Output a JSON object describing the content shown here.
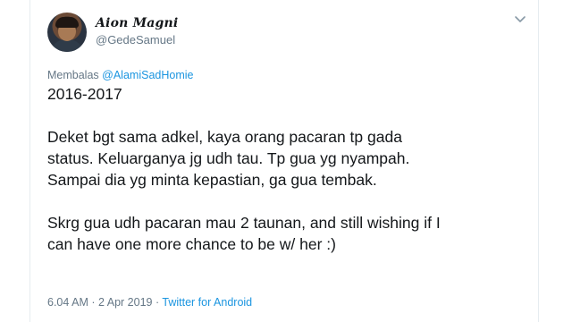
{
  "user": {
    "display_name": "Aion Magni",
    "handle": "@GedeSamuel"
  },
  "reply": {
    "prefix": "Membalas",
    "mention": "@AlamiSadHomie"
  },
  "tweet": {
    "line1": "2016-2017",
    "line2": "Deket bgt sama adkel, kaya orang pacaran tp gada",
    "line3": "status. Keluarganya jg udh tau. Tp gua yg nyampah.",
    "line4": "Sampai dia yg minta kepastian, ga gua tembak.",
    "line5": "Skrg gua udh pacaran mau 2 taunan, and still wishing if I",
    "line6": "can have one more chance to be w/ her :)"
  },
  "meta": {
    "time": "6.04 AM",
    "date": "2 Apr 2019",
    "separator": "·",
    "source": "Twitter for Android"
  },
  "icons": {
    "menu": "chevron-down-icon"
  },
  "colors": {
    "link": "#1b95e0",
    "secondary_text": "#657786",
    "primary_text": "#14171a"
  }
}
